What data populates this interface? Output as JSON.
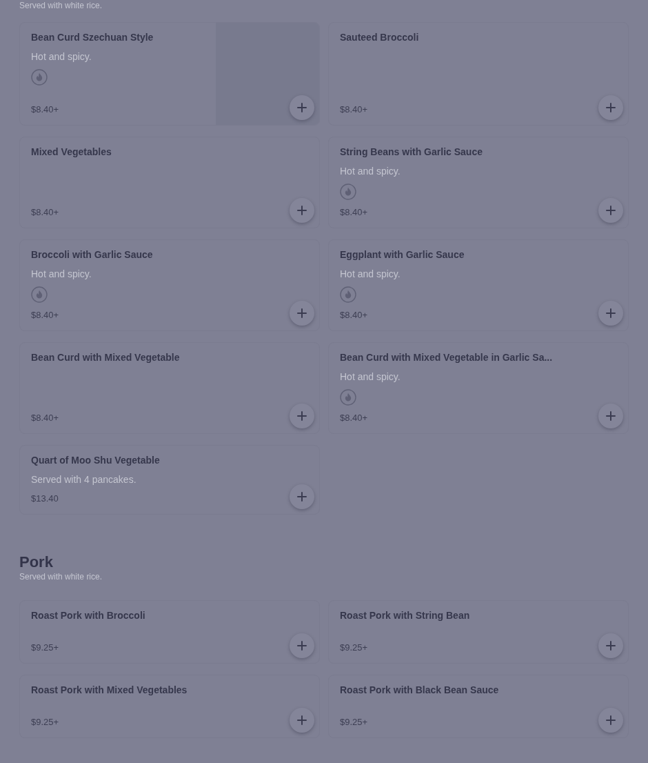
{
  "sections": [
    {
      "subtitle": "Served with white rice.",
      "items": [
        {
          "name": "Bean Curd Szechuan Style",
          "description": "Hot and spicy.",
          "spicy": true,
          "price": "$8.40+",
          "has_image": true
        },
        {
          "name": "Sauteed Broccoli",
          "spicy": false,
          "price": "$8.40+",
          "has_image": false
        },
        {
          "name": "Mixed Vegetables",
          "spicy": false,
          "price": "$8.40+",
          "has_image": false
        },
        {
          "name": "String Beans with Garlic Sauce",
          "description": "Hot and spicy.",
          "spicy": true,
          "price": "$8.40+",
          "has_image": false
        },
        {
          "name": "Broccoli with Garlic Sauce",
          "description": "Hot and spicy.",
          "spicy": true,
          "price": "$8.40+",
          "has_image": false
        },
        {
          "name": "Eggplant with Garlic Sauce",
          "description": "Hot and spicy.",
          "spicy": true,
          "price": "$8.40+",
          "has_image": false
        },
        {
          "name": "Bean Curd with Mixed Vegetable",
          "spicy": false,
          "price": "$8.40+",
          "has_image": false
        },
        {
          "name": "Bean Curd with Mixed Vegetable in Garlic Sa...",
          "description": "Hot and spicy.",
          "spicy": true,
          "price": "$8.40+",
          "has_image": false
        },
        {
          "name": "Quart of Moo Shu Vegetable",
          "description": "Served with 4 pancakes.",
          "spicy": false,
          "price": "$13.40",
          "has_image": false
        }
      ]
    },
    {
      "title": "Pork",
      "subtitle": "Served with white rice.",
      "items": [
        {
          "name": "Roast Pork with Broccoli",
          "spicy": false,
          "price": "$9.25+",
          "has_image": false
        },
        {
          "name": "Roast Pork with String Bean",
          "spicy": false,
          "price": "$9.25+",
          "has_image": false
        },
        {
          "name": "Roast Pork with Mixed Vegetables",
          "spicy": false,
          "price": "$9.25+",
          "has_image": false
        },
        {
          "name": "Roast Pork with Black Bean Sauce",
          "spicy": false,
          "price": "$9.25+",
          "has_image": false
        }
      ]
    }
  ]
}
